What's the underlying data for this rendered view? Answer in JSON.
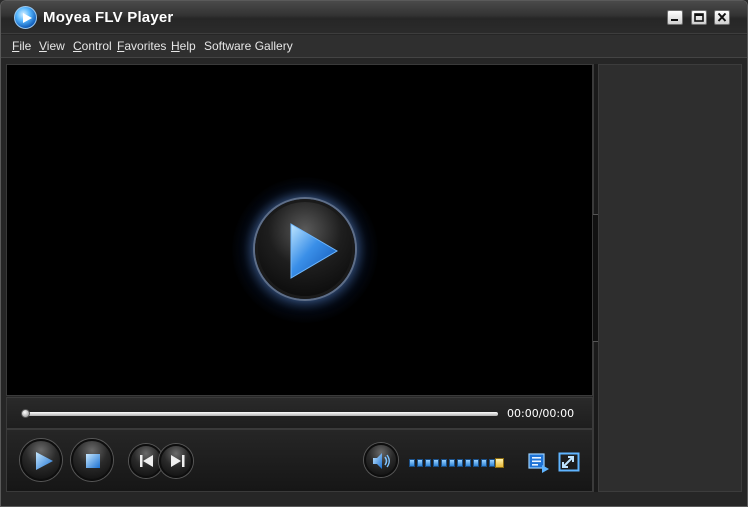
{
  "window": {
    "title": "Moyea FLV Player",
    "logo_icon": "play-logo-icon",
    "controls": {
      "minimize_icon": "minimize-icon",
      "maximize_icon": "maximize-icon",
      "close_icon": "close-icon"
    }
  },
  "menu": {
    "items": [
      {
        "label": "File",
        "accel": "F"
      },
      {
        "label": "View",
        "accel": "V"
      },
      {
        "label": "Control",
        "accel": "C"
      },
      {
        "label": "Favorites",
        "accel": "F"
      },
      {
        "label": "Help",
        "accel": "H"
      },
      {
        "label": "Software Gallery",
        "accel": ""
      }
    ]
  },
  "player": {
    "big_play_icon": "play-icon",
    "progress": 0,
    "time_display": "00:00/00:00",
    "volume_level": 0.9,
    "buttons": {
      "play_icon": "play-icon",
      "stop_icon": "stop-icon",
      "previous_icon": "previous-track-icon",
      "next_icon": "next-track-icon",
      "volume_icon": "speaker-icon",
      "playlist_icon": "playlist-icon",
      "fullscreen_icon": "fullscreen-icon"
    }
  },
  "colors": {
    "accent_blue": "#3a8fe8",
    "background": "#262626",
    "video_bg": "#000000",
    "volume_knob": "#e8b838"
  }
}
